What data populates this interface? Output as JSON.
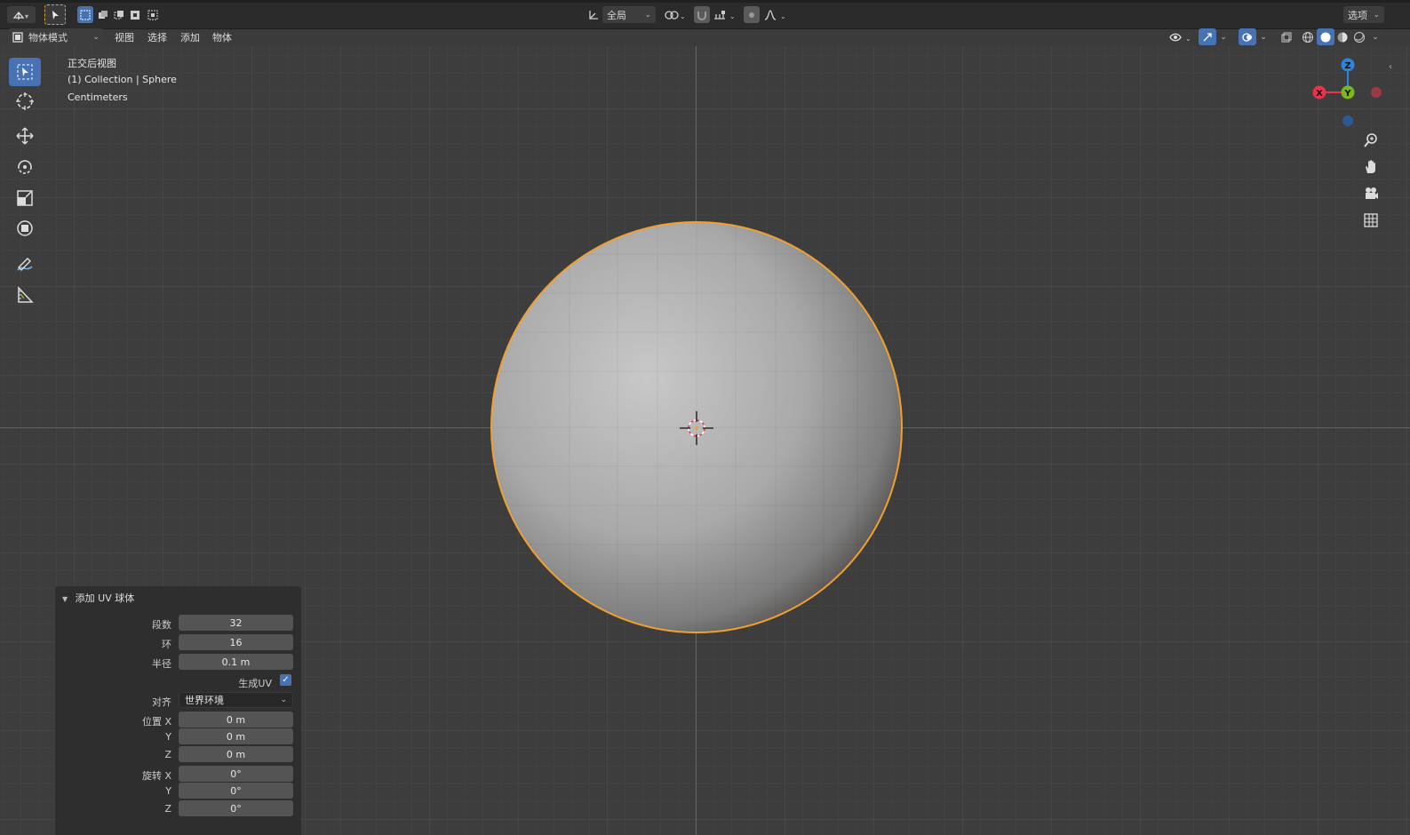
{
  "topbar": {
    "orientation_label": "全局",
    "options_label": "选项"
  },
  "header": {
    "mode_label": "物体模式",
    "menus": [
      "视图",
      "选择",
      "添加",
      "物体"
    ]
  },
  "viewport": {
    "view_name": "正交后视图",
    "collection_label": "(1) Collection | Sphere",
    "units_label": "Centimeters"
  },
  "gizmo": {
    "z_label": "Z",
    "x_label": "X",
    "y_label": "Y"
  },
  "operator_panel": {
    "title": "添加 UV 球体",
    "segments_label": "段数",
    "segments_value": "32",
    "rings_label": "环",
    "rings_value": "16",
    "radius_label": "半径",
    "radius_value": "0.1 m",
    "generate_uv_label": "生成UV",
    "generate_uv_checked": true,
    "align_label": "对齐",
    "align_value": "世界环境",
    "location_label": "位置 X",
    "location_y_label": "Y",
    "location_z_label": "Z",
    "location_x": "0 m",
    "location_y": "0 m",
    "location_z": "0 m",
    "rotation_label": "旋转 X",
    "rotation_y_label": "Y",
    "rotation_z_label": "Z",
    "rotation_x": "0°",
    "rotation_y": "0°",
    "rotation_z": "0°"
  },
  "colors": {
    "selection_outline": "#f0a030",
    "accent": "#4772b3",
    "x_axis": "#e8334e",
    "y_axis": "#7ab81e",
    "z_axis": "#2a85e0"
  }
}
